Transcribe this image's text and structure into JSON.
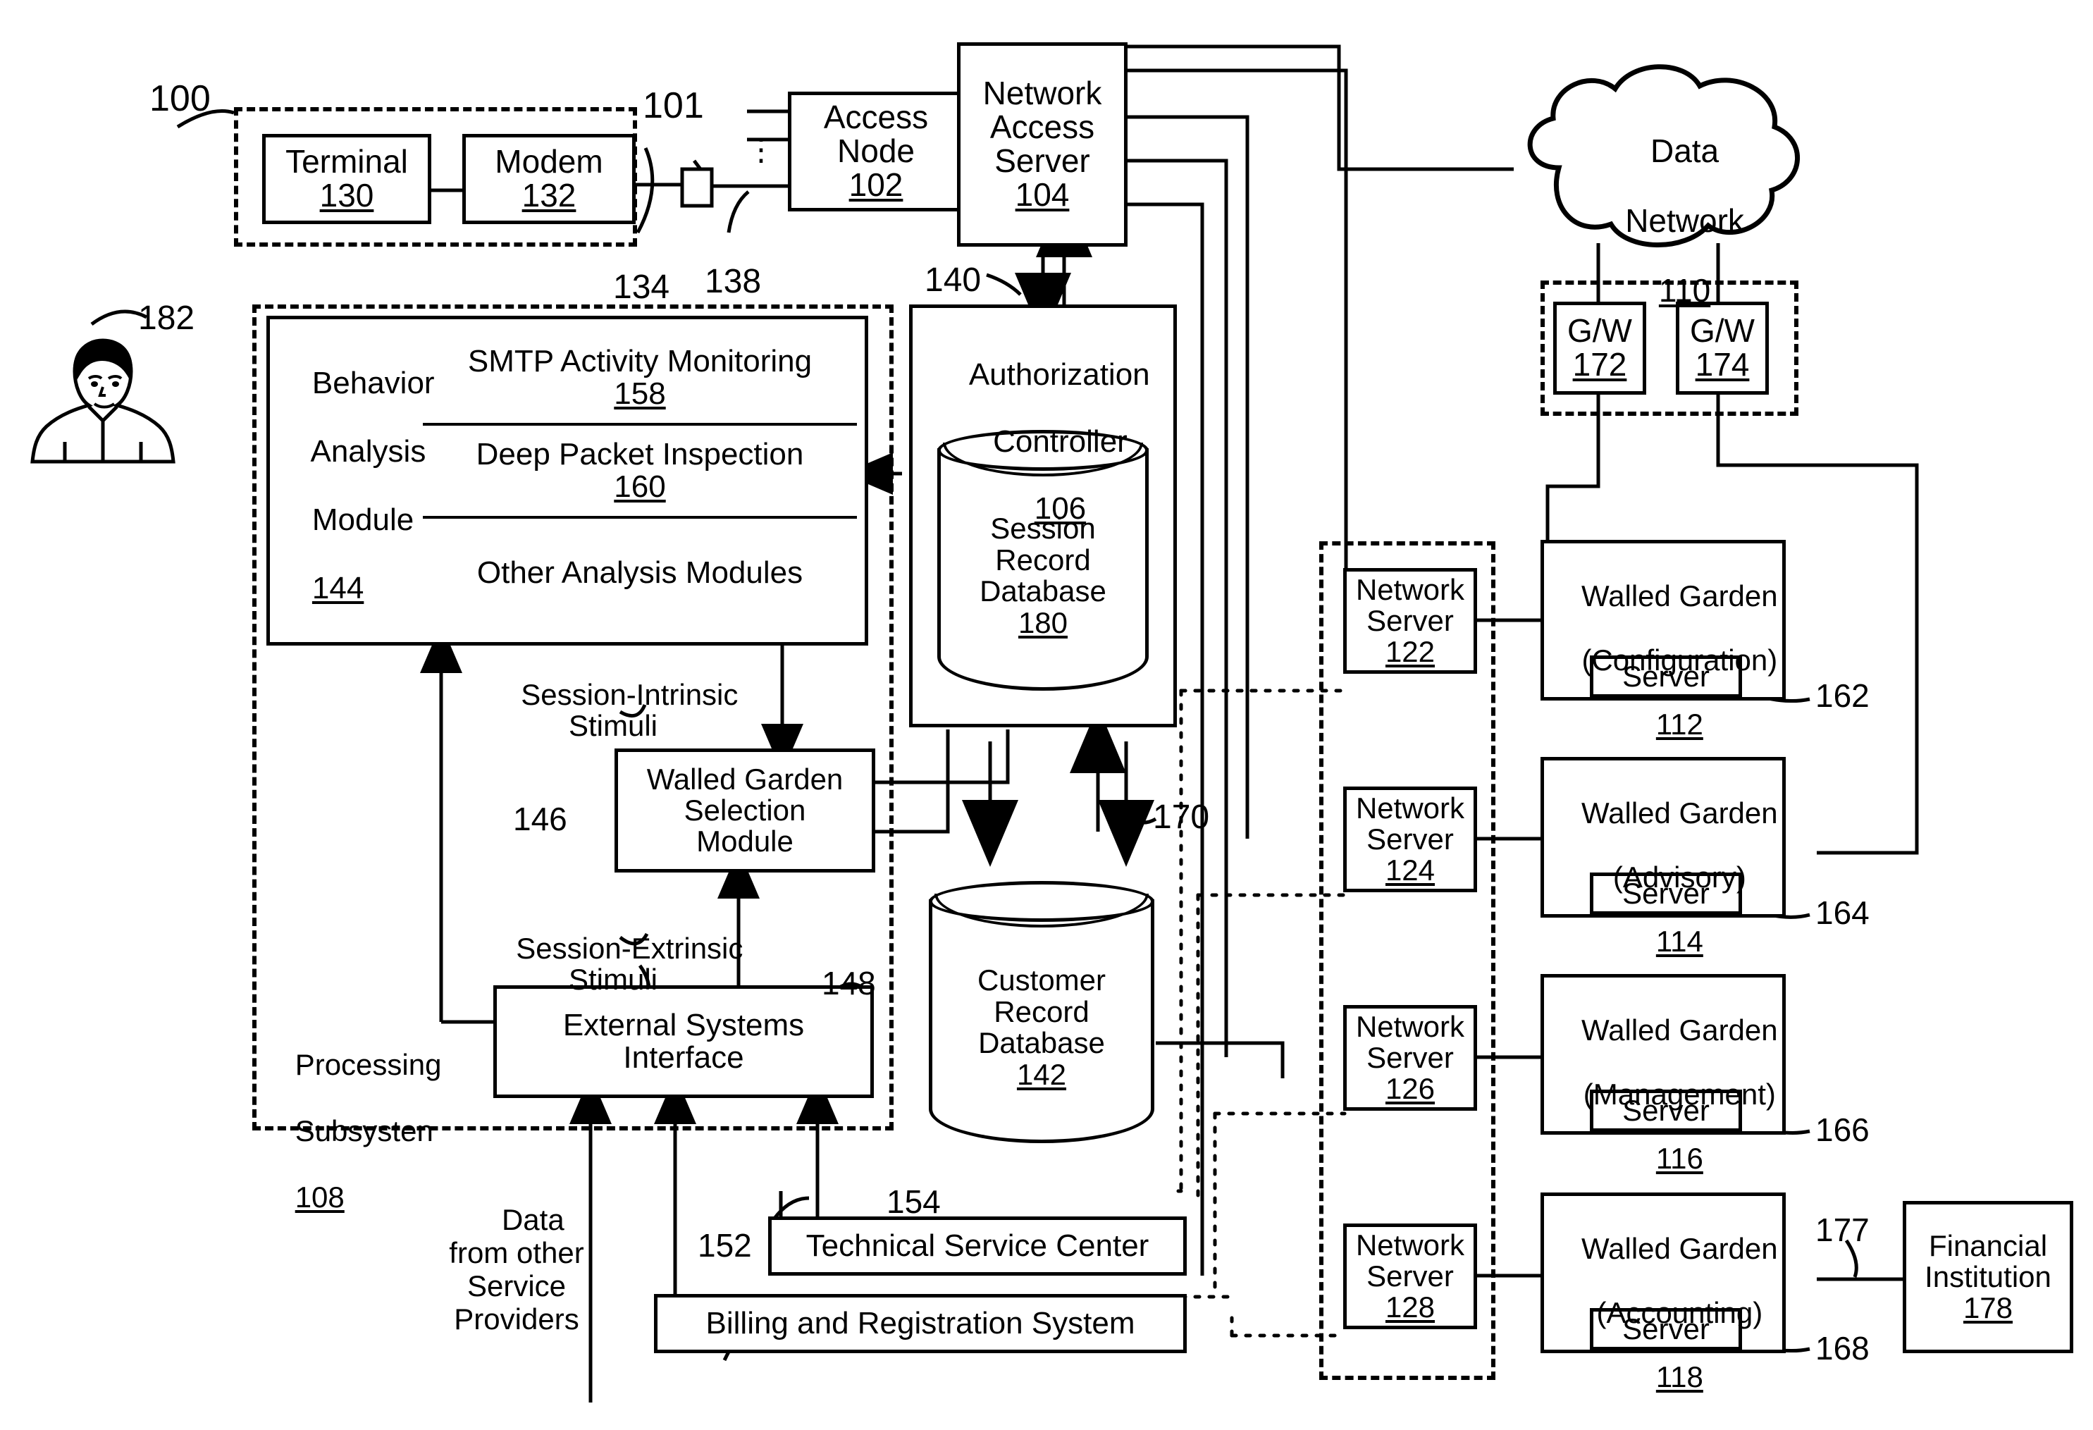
{
  "figure": {
    "type": "patent-block-diagram",
    "system_ref": "100",
    "customer_premises_ref": "101"
  },
  "blocks": {
    "terminal": {
      "title": "Terminal",
      "num": "130"
    },
    "modem": {
      "title": "Modem",
      "num": "132"
    },
    "access_node": {
      "line1": "Access",
      "line2": "Node",
      "num": "102"
    },
    "nas": {
      "line1": "Network",
      "line2": "Access",
      "line3": "Server",
      "num": "104"
    },
    "data_network": {
      "line1": "Data",
      "line2": "Network",
      "num": "110"
    },
    "gw1": {
      "title": "G/W",
      "num": "172"
    },
    "gw2": {
      "title": "G/W",
      "num": "174"
    },
    "behavior_module": {
      "line1": "Behavior",
      "line2": "Analysis",
      "line3": "Module",
      "num": "144"
    },
    "smtp": {
      "title": "SMTP Activity Monitoring",
      "num": "158"
    },
    "dpi": {
      "title": "Deep Packet Inspection",
      "num": "160"
    },
    "other_analysis": {
      "title": "Other Analysis Modules"
    },
    "auth_controller": {
      "line1": "Authorization",
      "line2": "Controller",
      "num": "106"
    },
    "session_db": {
      "line1": "Session",
      "line2": "Record",
      "line3": "Database",
      "num": "180"
    },
    "customer_db": {
      "line1": "Customer",
      "line2": "Record",
      "line3": "Database",
      "num": "142"
    },
    "wg_selection": {
      "line1": "Walled Garden",
      "line2": "Selection",
      "line3": "Module",
      "num": "146"
    },
    "ext_interface": {
      "line1": "External Systems",
      "line2": "Interface",
      "num": "148"
    },
    "tech_center": {
      "title": "Technical Service Center",
      "num": "154"
    },
    "billing": {
      "title": "Billing and Registration System",
      "num": "152"
    },
    "processing_sub": {
      "line1": "Processing",
      "line2": "Subsysten",
      "num": "108"
    },
    "ns122": {
      "line1": "Network",
      "line2": "Server",
      "num": "122"
    },
    "ns124": {
      "line1": "Network",
      "line2": "Server",
      "num": "124"
    },
    "ns126": {
      "line1": "Network",
      "line2": "Server",
      "num": "126"
    },
    "ns128": {
      "line1": "Network",
      "line2": "Server",
      "num": "128"
    },
    "wg_config": {
      "line1": "Walled Garden",
      "line2": "(Configuration)",
      "num": "112",
      "server": "Server",
      "server_ref": "162"
    },
    "wg_advisory": {
      "line1": "Walled Garden",
      "line2": "(Advisory)",
      "num": "114",
      "server": "Server",
      "server_ref": "164"
    },
    "wg_management": {
      "line1": "Walled Garden",
      "line2": "(Management)",
      "num": "116",
      "server": "Server",
      "server_ref": "166"
    },
    "wg_accounting": {
      "line1": "Walled Garden",
      "line2": "(Accounting)",
      "num": "118",
      "server": "Server",
      "server_ref": "168"
    },
    "financial": {
      "line1": "Financial",
      "line2": "Institution",
      "num": "178"
    }
  },
  "annotations": {
    "user_ref": "182",
    "link_134": "134",
    "link_138": "138",
    "link_140": "140",
    "link_170": "170",
    "link_177": "177",
    "session_intrinsic": "Session-Intrinsic\nStimuli",
    "session_extrinsic": "Session-Extrinsic\nStimuli",
    "data_other_providers": "Data\nfrom other\nService\nProviders",
    "vertical_dots": "⋮"
  },
  "colors": {
    "ink": "#000000",
    "paper": "#ffffff"
  }
}
